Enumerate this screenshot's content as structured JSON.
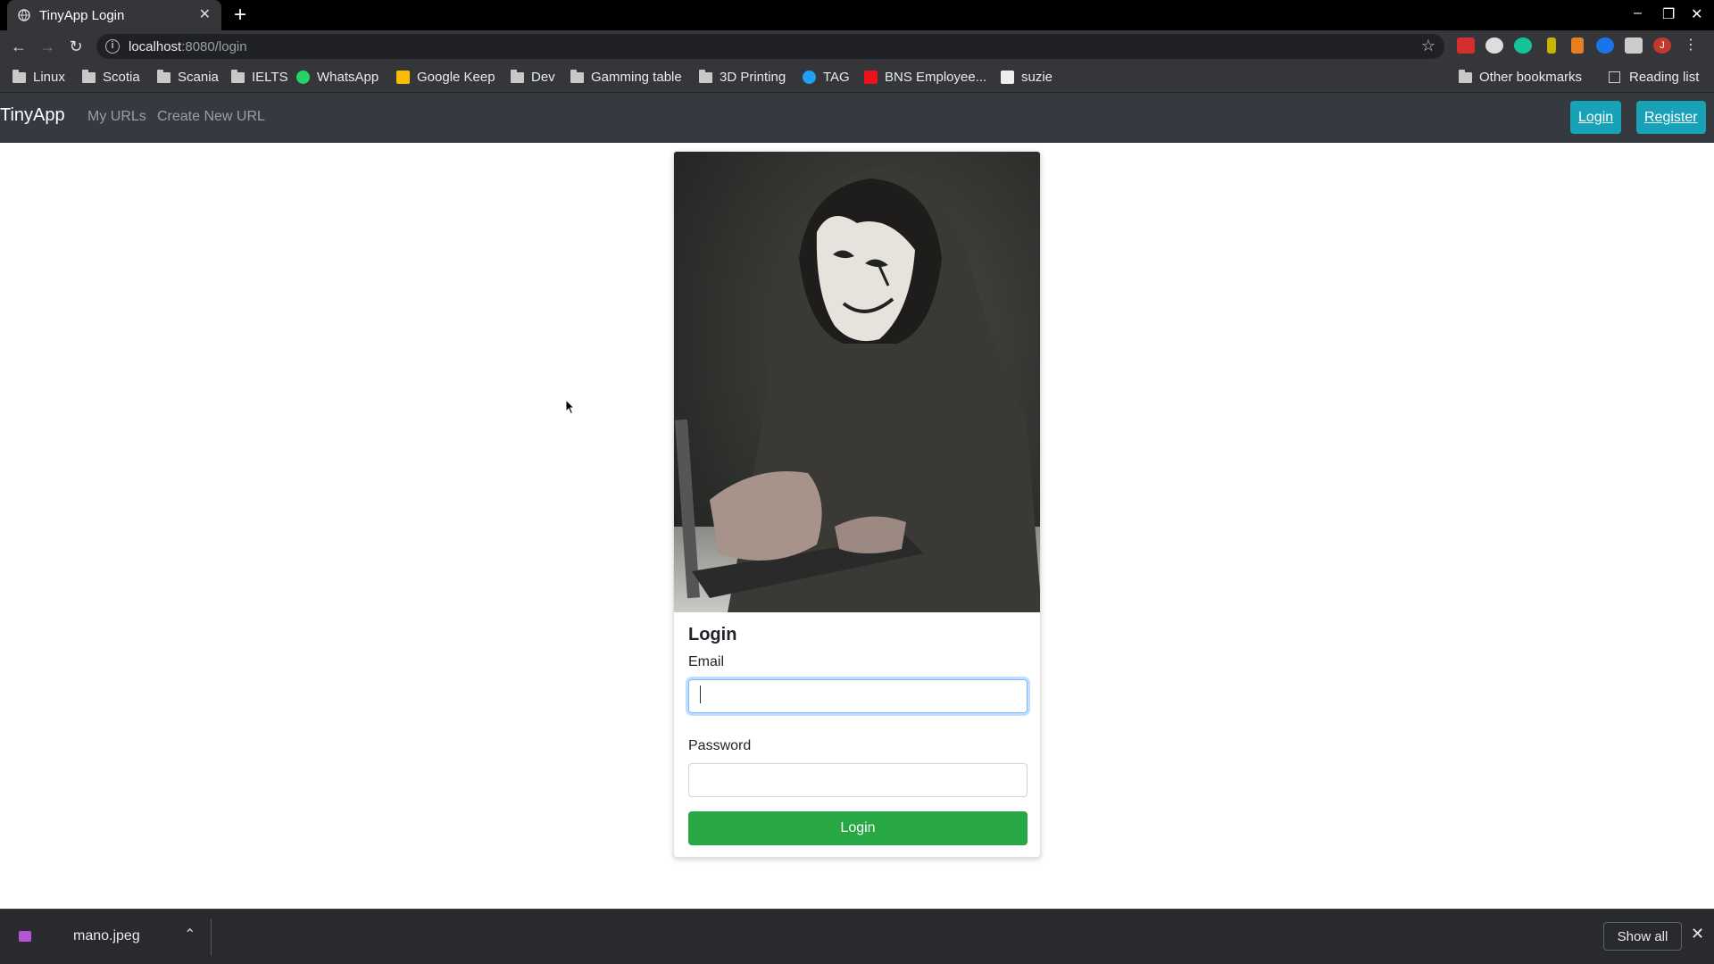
{
  "browser": {
    "tab_title": "TinyApp Login",
    "tab_close": "✕",
    "new_tab": "+",
    "url_host": "localhost",
    "url_path": ":8080/login",
    "window_controls": [
      "–",
      "❐",
      "✕"
    ],
    "bookmarks": [
      {
        "label": "Linux",
        "icon": "folder-icon"
      },
      {
        "label": "Scotia",
        "icon": "folder-icon"
      },
      {
        "label": "Scania",
        "icon": "folder-icon"
      },
      {
        "label": "IELTS",
        "icon": "folder-icon"
      },
      {
        "label": "WhatsApp",
        "icon": "whatsapp-icon"
      },
      {
        "label": "Google Keep",
        "icon": "google-keep-icon"
      },
      {
        "label": "Dev",
        "icon": "folder-icon"
      },
      {
        "label": "Gamming table",
        "icon": "folder-icon"
      },
      {
        "label": "3D Printing",
        "icon": "folder-icon"
      },
      {
        "label": "TAG",
        "icon": "twitter-icon"
      },
      {
        "label": "BNS Employee...",
        "icon": "scotiabank-icon"
      },
      {
        "label": "suzie",
        "icon": "amazon-icon"
      }
    ],
    "other_bookmarks": "Other bookmarks",
    "reading_list": "Reading list",
    "profile_initial": "J"
  },
  "app": {
    "brand": "TinyApp",
    "nav_links": [
      "My URLs",
      "Create New URL"
    ],
    "login_button": "Login",
    "register_button": "Register"
  },
  "login_card": {
    "title": "Login",
    "email_label": "Email",
    "email_value": "",
    "password_label": "Password",
    "password_value": "",
    "submit_label": "Login"
  },
  "downloads": {
    "file_name": "mano.jpeg",
    "show_all": "Show all",
    "close": "✕"
  },
  "colors": {
    "navbar": "#343a40",
    "info": "#17a2b8",
    "success": "#28a745"
  }
}
